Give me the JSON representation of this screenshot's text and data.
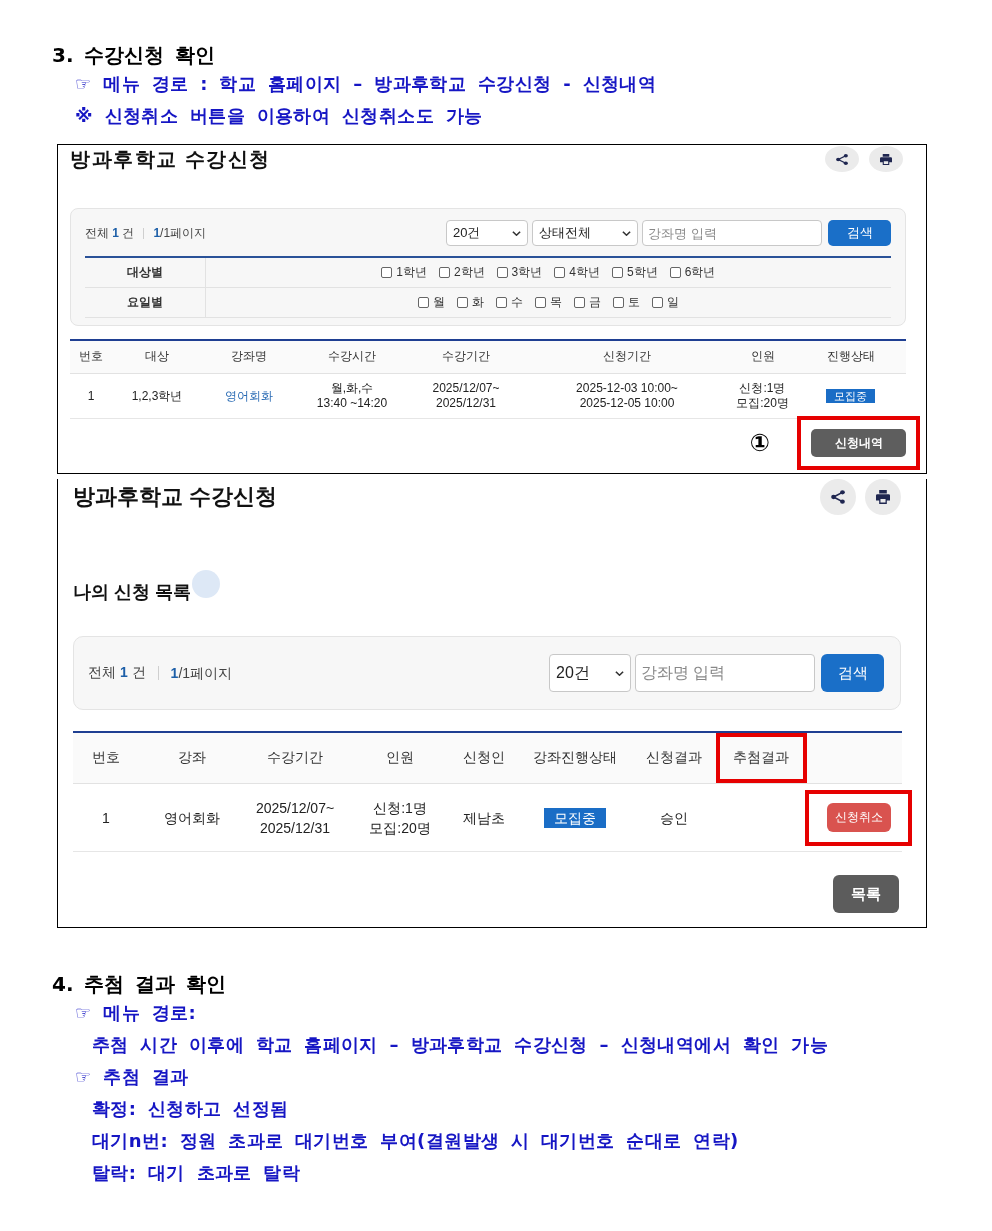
{
  "section_3": {
    "heading": "3. 수강신청 확인",
    "lines": [
      {
        "kind": "bullet",
        "text": "☞ 메뉴 경로 : 학교 홈페이지 – 방과후학교 수강신청 - 신청내역"
      },
      {
        "kind": "bullet",
        "text": "※ 신청취소 버튼을 이용하여 신청취소도 가능"
      }
    ]
  },
  "screenshot_1": {
    "title": "방과후학교 수강신청",
    "summary": {
      "count": "전체 **1** 건",
      "pages": "**1**/1페이지"
    },
    "page_size": "20건",
    "status_filter": "상태전체",
    "search": {
      "placeholder": "강좌명 입력"
    },
    "search_button": "검색",
    "filter_rows": [
      {
        "label": "대상별",
        "options": [
          {
            "label": "1학년",
            "checked": false
          },
          {
            "label": "2학년",
            "checked": false
          },
          {
            "label": "3학년",
            "checked": false
          },
          {
            "label": "4학년",
            "checked": false
          },
          {
            "label": "5학년",
            "checked": false
          },
          {
            "label": "6학년",
            "checked": false
          }
        ]
      },
      {
        "label": "요일별",
        "options": [
          {
            "label": "월",
            "checked": false
          },
          {
            "label": "화",
            "checked": false
          },
          {
            "label": "수",
            "checked": false
          },
          {
            "label": "목",
            "checked": false
          },
          {
            "label": "금",
            "checked": false
          },
          {
            "label": "토",
            "checked": false
          },
          {
            "label": "일",
            "checked": false
          }
        ]
      }
    ],
    "table": {
      "columns": [
        "번호",
        "대상",
        "강좌명",
        "수강시간",
        "수강기간",
        "신청기간",
        "인원",
        "진행상태"
      ],
      "rows": [
        {
          "cells": [
            {
              "kind": "text",
              "text": "1"
            },
            {
              "kind": "text",
              "text": "1,2,3학년"
            },
            {
              "kind": "link",
              "text": "영어회화"
            },
            {
              "kind": "text",
              "text": "월,화,수\n13:40 ~14:20"
            },
            {
              "kind": "text",
              "text": "2025/12/07~\n2025/12/31"
            },
            {
              "kind": "text",
              "text": "2025-12-03 10:00~\n2025-12-05 10:00"
            },
            {
              "kind": "text",
              "text": "신청:1명\n모집:20명"
            },
            {
              "kind": "badge",
              "text": "모집중"
            }
          ]
        }
      ]
    },
    "step_marker": "①",
    "history_button": {
      "label": "신청내역",
      "highlighted": true
    }
  },
  "screenshot_2": {
    "title": "방과후학교 수강신청",
    "list_title": "나의 신청 목록",
    "summary": {
      "count": "전체 **1** 건",
      "pages": "**1**/1페이지"
    },
    "page_size": "20건",
    "search": {
      "placeholder": "강좌명 입력"
    },
    "search_button": "검색",
    "table": {
      "columns": [
        {
          "label": "번호",
          "highlighted": false
        },
        {
          "label": "강좌",
          "highlighted": false
        },
        {
          "label": "수강기간",
          "highlighted": false
        },
        {
          "label": "인원",
          "highlighted": false
        },
        {
          "label": "신청인",
          "highlighted": false
        },
        {
          "label": "강좌진행상태",
          "highlighted": false
        },
        {
          "label": "신청결과",
          "highlighted": false
        },
        {
          "label": "추첨결과",
          "highlighted": true
        }
      ],
      "rows": [
        {
          "cells": [
            {
              "kind": "text",
              "text": "1"
            },
            {
              "kind": "text",
              "text": "영어회화"
            },
            {
              "kind": "text",
              "text": "2025/12/07~\n2025/12/31"
            },
            {
              "kind": "text",
              "text": "신청:1명\n모집:20명"
            },
            {
              "kind": "text",
              "text": "제남초"
            },
            {
              "kind": "badge",
              "text": "모집중"
            },
            {
              "kind": "text",
              "text": "승인"
            },
            {
              "kind": "empty"
            },
            {
              "kind": "button",
              "text": "신청취소",
              "highlighted": true
            }
          ]
        }
      ]
    },
    "list_button": "목록"
  },
  "section_4": {
    "heading": "4. 추첨 결과 확인",
    "lines": [
      {
        "kind": "bullet",
        "text": "☞ 메뉴 경로:"
      },
      {
        "kind": "detail",
        "text": "추첨 시간 이후에 학교 홈페이지 – 방과후학교 수강신청 – 신청내역에서 확인 가능"
      },
      {
        "kind": "bullet",
        "text": "☞ 추첨 결과"
      },
      {
        "kind": "detail",
        "text": "확정: 신청하고 선정됨"
      },
      {
        "kind": "detail",
        "text": "대기n번: 정원 초과로 대기번호 부여(결원발생 시 대기번호 순대로 연락)"
      },
      {
        "kind": "detail",
        "text": "탈락: 대기 초과로 탈락"
      }
    ]
  }
}
